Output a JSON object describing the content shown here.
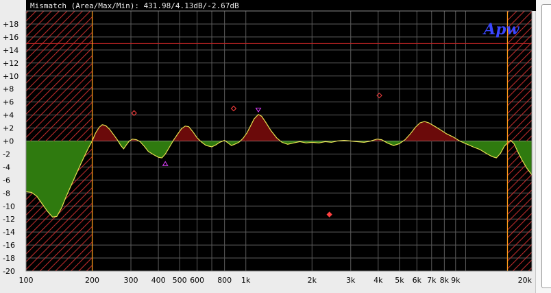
{
  "title_bar": {
    "text": "Mismatch (Area/Max/Min): 431.98/4.13dB/-2.67dB"
  },
  "logo_text": "Apw",
  "colors": {
    "background": "#000000",
    "grid": "#5c5c5c",
    "axis_line": "#c8c8c8",
    "positive_fill": "#6b0a0a",
    "negative_fill": "#2f7a0f",
    "curve": "#e6e050",
    "hatch": "#d03030",
    "range_marker": "#ff9a1a",
    "limit_line": "#c32424",
    "diamond_marker": "#ff4040",
    "triangle_marker": "#e040ff"
  },
  "chart_data": {
    "type": "area",
    "title": "Mismatch (Area/Max/Min): 431.98/4.13dB/-2.67dB",
    "xlabel": "",
    "ylabel": "",
    "xscale": "log",
    "xlim": [
      100,
      20000
    ],
    "ylim": [
      -20,
      20
    ],
    "grid": true,
    "x_ticks": [
      {
        "value": 100,
        "label": "100"
      },
      {
        "value": 200,
        "label": "200"
      },
      {
        "value": 300,
        "label": "300"
      },
      {
        "value": 400,
        "label": "400"
      },
      {
        "value": 500,
        "label": "500"
      },
      {
        "value": 600,
        "label": "600"
      },
      {
        "value": 800,
        "label": "800"
      },
      {
        "value": 1000,
        "label": "1k"
      },
      {
        "value": 2000,
        "label": "2k"
      },
      {
        "value": 3000,
        "label": "3k"
      },
      {
        "value": 4000,
        "label": "4k"
      },
      {
        "value": 5000,
        "label": "5k"
      },
      {
        "value": 6000,
        "label": "6k"
      },
      {
        "value": 7000,
        "label": "7k"
      },
      {
        "value": 8000,
        "label": "8k"
      },
      {
        "value": 9000,
        "label": "9k"
      },
      {
        "value": 20000,
        "label": "20k"
      }
    ],
    "minor_x_grid": [
      700,
      10000
    ],
    "y_ticks": [
      {
        "value": 18,
        "label": "+18"
      },
      {
        "value": 16,
        "label": "+16"
      },
      {
        "value": 14,
        "label": "+14"
      },
      {
        "value": 12,
        "label": "+12"
      },
      {
        "value": 10,
        "label": "+10"
      },
      {
        "value": 8,
        "label": "+8"
      },
      {
        "value": 6,
        "label": "+6"
      },
      {
        "value": 4,
        "label": "+4"
      },
      {
        "value": 2,
        "label": "+2"
      },
      {
        "value": 0,
        "label": "+0"
      },
      {
        "value": -2,
        "label": "-2"
      },
      {
        "value": -4,
        "label": "-4"
      },
      {
        "value": -6,
        "label": "-6"
      },
      {
        "value": -8,
        "label": "-8"
      },
      {
        "value": -10,
        "label": "-10"
      },
      {
        "value": -12,
        "label": "-12"
      },
      {
        "value": -14,
        "label": "-14"
      },
      {
        "value": -16,
        "label": "-16"
      },
      {
        "value": -18,
        "label": "-18"
      },
      {
        "value": -20,
        "label": "-20"
      }
    ],
    "hatched_regions": [
      {
        "from": 100,
        "to": 200
      },
      {
        "from": 15500,
        "to": 20000
      }
    ],
    "range_lines": [
      200,
      15500
    ],
    "limit_line": 15,
    "series": [
      {
        "points": [
          [
            100,
            -7.8
          ],
          [
            106,
            -7.9
          ],
          [
            112,
            -8.5
          ],
          [
            118,
            -9.6
          ],
          [
            125,
            -10.8
          ],
          [
            132,
            -11.7
          ],
          [
            138,
            -11.6
          ],
          [
            145,
            -10.3
          ],
          [
            152,
            -8.6
          ],
          [
            160,
            -6.9
          ],
          [
            168,
            -5.3
          ],
          [
            176,
            -3.8
          ],
          [
            184,
            -2.4
          ],
          [
            192,
            -1.1
          ],
          [
            200,
            0.0
          ],
          [
            207,
            1.2
          ],
          [
            215,
            2.1
          ],
          [
            222,
            2.5
          ],
          [
            230,
            2.4
          ],
          [
            240,
            1.8
          ],
          [
            250,
            1.0
          ],
          [
            260,
            0.2
          ],
          [
            270,
            -0.7
          ],
          [
            278,
            -1.2
          ],
          [
            286,
            -0.6
          ],
          [
            295,
            0.0
          ],
          [
            305,
            0.3
          ],
          [
            318,
            0.2
          ],
          [
            330,
            -0.1
          ],
          [
            345,
            -0.8
          ],
          [
            360,
            -1.6
          ],
          [
            380,
            -2.1
          ],
          [
            400,
            -2.5
          ],
          [
            415,
            -2.6
          ],
          [
            430,
            -2.0
          ],
          [
            450,
            -0.9
          ],
          [
            470,
            0.2
          ],
          [
            490,
            1.1
          ],
          [
            510,
            1.9
          ],
          [
            530,
            2.3
          ],
          [
            550,
            2.2
          ],
          [
            575,
            1.4
          ],
          [
            600,
            0.5
          ],
          [
            630,
            -0.2
          ],
          [
            660,
            -0.7
          ],
          [
            700,
            -0.9
          ],
          [
            730,
            -0.6
          ],
          [
            760,
            -0.2
          ],
          [
            800,
            0.1
          ],
          [
            830,
            -0.3
          ],
          [
            860,
            -0.7
          ],
          [
            890,
            -0.5
          ],
          [
            930,
            -0.2
          ],
          [
            970,
            0.4
          ],
          [
            1010,
            1.2
          ],
          [
            1050,
            2.3
          ],
          [
            1090,
            3.4
          ],
          [
            1140,
            4.1
          ],
          [
            1180,
            3.8
          ],
          [
            1230,
            2.9
          ],
          [
            1300,
            1.6
          ],
          [
            1380,
            0.5
          ],
          [
            1460,
            -0.2
          ],
          [
            1550,
            -0.5
          ],
          [
            1650,
            -0.3
          ],
          [
            1760,
            -0.1
          ],
          [
            1880,
            -0.3
          ],
          [
            2000,
            -0.2
          ],
          [
            2150,
            -0.3
          ],
          [
            2300,
            -0.1
          ],
          [
            2450,
            -0.2
          ],
          [
            2600,
            0.0
          ],
          [
            2800,
            0.1
          ],
          [
            3000,
            0.0
          ],
          [
            3200,
            -0.1
          ],
          [
            3450,
            -0.2
          ],
          [
            3700,
            0.0
          ],
          [
            3950,
            0.3
          ],
          [
            4150,
            0.2
          ],
          [
            4400,
            -0.3
          ],
          [
            4700,
            -0.7
          ],
          [
            5000,
            -0.4
          ],
          [
            5300,
            0.2
          ],
          [
            5600,
            1.1
          ],
          [
            5900,
            2.1
          ],
          [
            6200,
            2.8
          ],
          [
            6500,
            3.0
          ],
          [
            6800,
            2.8
          ],
          [
            7200,
            2.3
          ],
          [
            7700,
            1.7
          ],
          [
            8200,
            1.1
          ],
          [
            8800,
            0.6
          ],
          [
            9400,
            0.0
          ],
          [
            10000,
            -0.4
          ],
          [
            10800,
            -0.9
          ],
          [
            11600,
            -1.3
          ],
          [
            12400,
            -1.9
          ],
          [
            13200,
            -2.4
          ],
          [
            13800,
            -2.6
          ],
          [
            14400,
            -1.9
          ],
          [
            15000,
            -0.8
          ],
          [
            15500,
            -0.3
          ],
          [
            16000,
            0.1
          ],
          [
            16600,
            -0.4
          ],
          [
            17300,
            -1.7
          ],
          [
            18100,
            -3.0
          ],
          [
            19000,
            -4.2
          ],
          [
            20000,
            -5.2
          ]
        ]
      }
    ],
    "diamond_markers": [
      {
        "x": 310,
        "y": 4.3,
        "filled": false
      },
      {
        "x": 880,
        "y": 5.0,
        "filled": false
      },
      {
        "x": 2400,
        "y": -11.3,
        "filled": true
      },
      {
        "x": 4050,
        "y": 7.0,
        "filled": false
      }
    ],
    "triangle_markers": [
      {
        "x": 1140,
        "y": 4.7,
        "direction": "down"
      },
      {
        "x": 430,
        "y": -3.4,
        "direction": "up"
      }
    ]
  }
}
